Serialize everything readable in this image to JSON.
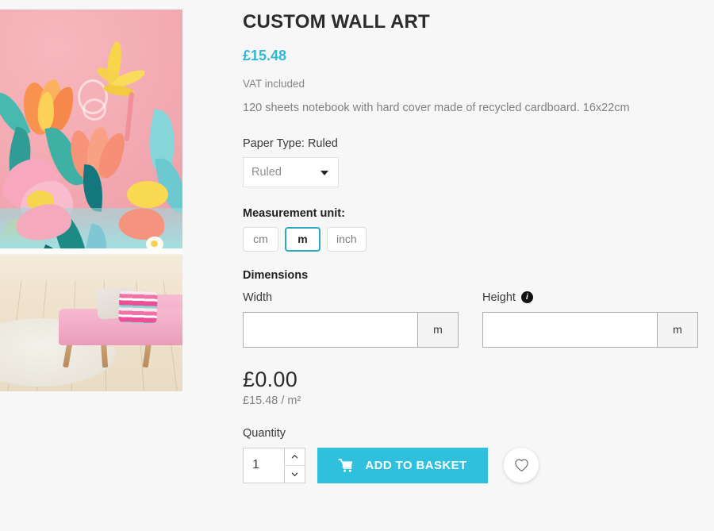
{
  "product": {
    "title": "CUSTOM WALL ART",
    "price": "£15.48",
    "vat_note": "VAT included",
    "description": "120 sheets notebook with hard cover made of recycled cardboard. 16x22cm"
  },
  "paper_type": {
    "label": "Paper Type: Ruled",
    "selected": "Ruled",
    "options": [
      "Ruled"
    ]
  },
  "measurement": {
    "label": "Measurement unit:",
    "units": [
      {
        "label": "cm",
        "active": false
      },
      {
        "label": "m",
        "active": true
      },
      {
        "label": "inch",
        "active": false
      }
    ]
  },
  "dimensions": {
    "heading": "Dimensions",
    "width": {
      "label": "Width",
      "value": "",
      "placeholder": "",
      "suffix": "m"
    },
    "height": {
      "label": "Height",
      "value": "",
      "placeholder": "",
      "suffix": "m",
      "info_icon": "info-icon",
      "info_glyph": "i"
    }
  },
  "totals": {
    "total": "£0.00",
    "unit_price": "£15.48 / m²"
  },
  "purchase": {
    "quantity_label": "Quantity",
    "quantity_value": "1",
    "add_to_basket": "Add to basket",
    "cart_icon": "shopping-cart-icon",
    "wishlist_icon": "heart-icon",
    "stepper_up_icon": "chevron-up-icon",
    "stepper_down_icon": "chevron-down-icon"
  },
  "gallery": {
    "image_alt": "Floral mural wallpaper in living room with pink sofa",
    "image_name": "product-image"
  },
  "colors": {
    "accent": "#2fc0de",
    "price": "#2fb8d8",
    "unit_active_border": "#29aabf",
    "page_background": "#f7f7f7",
    "text_muted": "#7f8185",
    "text_dark": "#2b2b2b"
  }
}
